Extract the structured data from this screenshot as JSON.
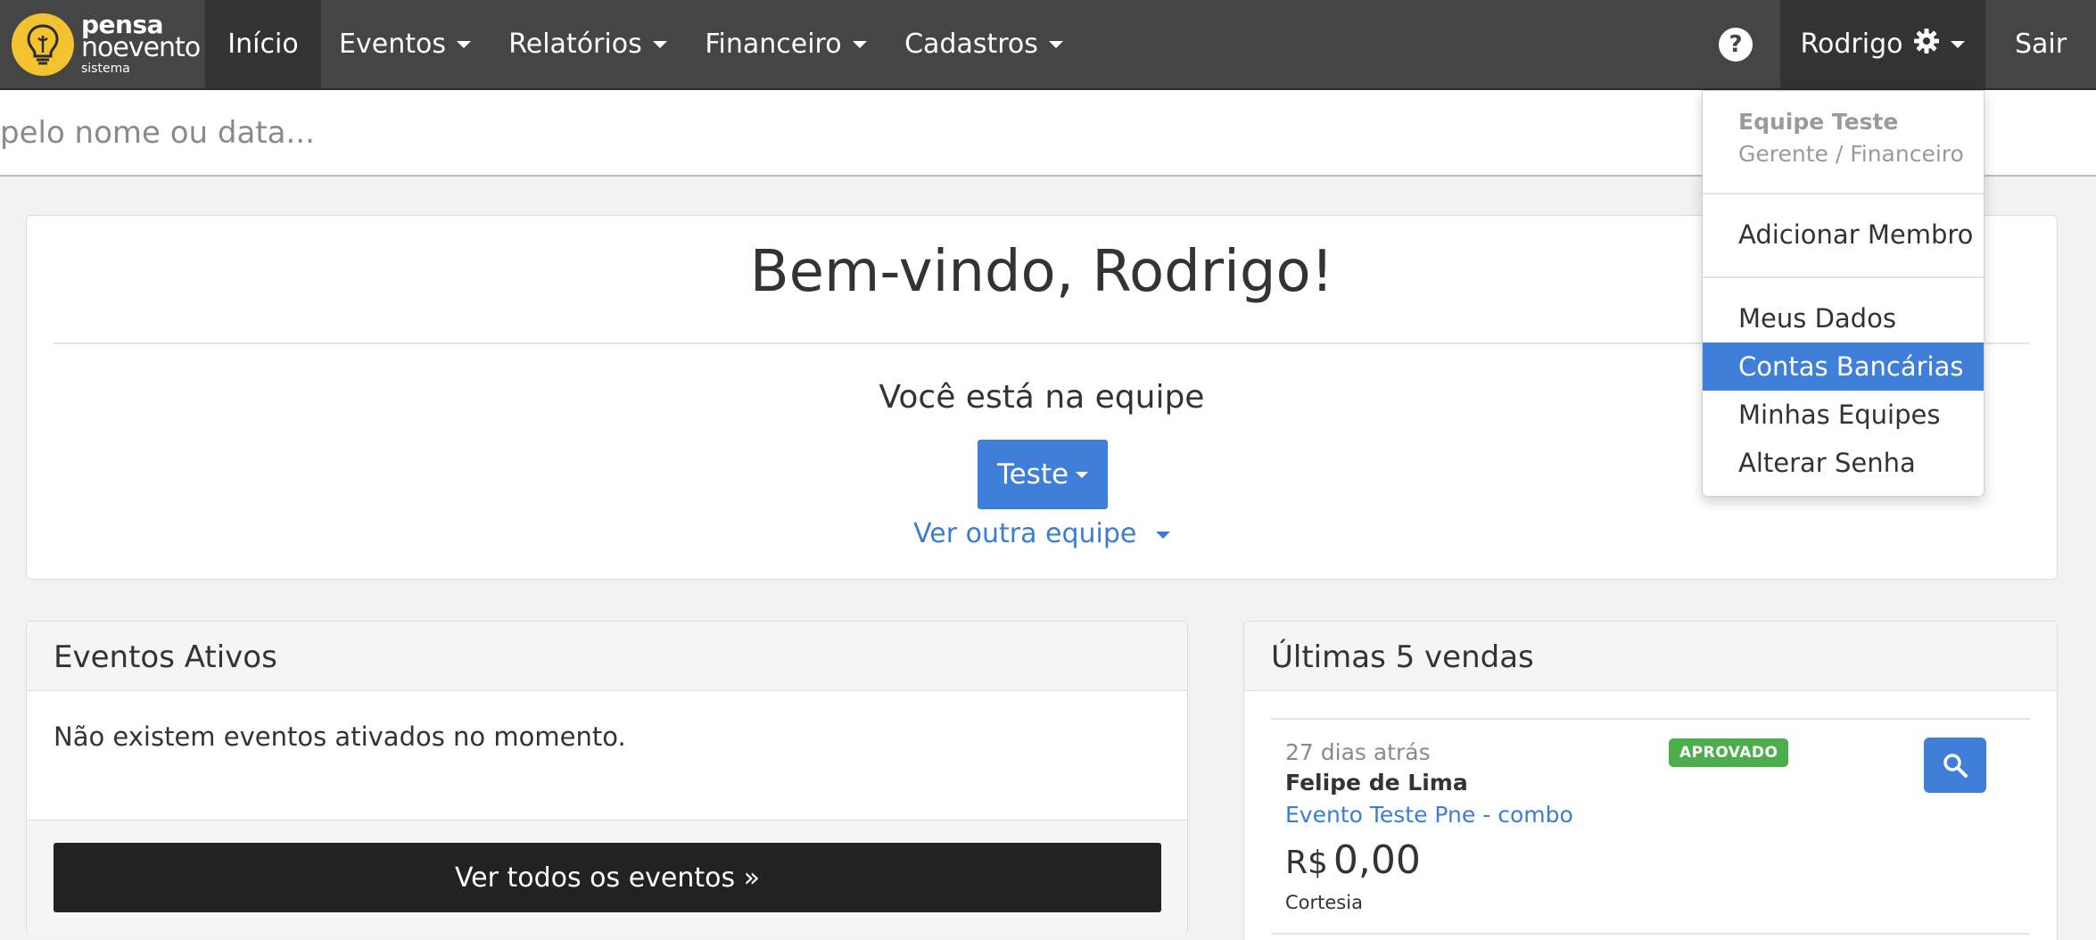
{
  "brand": {
    "line1": "pensa",
    "line2": "noevento",
    "line3": "sistema",
    "logo_icon": "lightbulb-icon",
    "logo_color": "#f2c230"
  },
  "nav": {
    "home": "Início",
    "events": "Eventos",
    "reports": "Relatórios",
    "financial": "Financeiro",
    "registers": "Cadastros",
    "help_symbol": "?",
    "user": "Rodrigo",
    "logout": "Sair"
  },
  "search": {
    "placeholder": "pelo nome ou data..."
  },
  "welcome": {
    "title": "Bem-vindo, Rodrigo!",
    "subtitle": "Você está na equipe",
    "team_button": "Teste",
    "other_team": "Ver outra equipe"
  },
  "active_events": {
    "title": "Eventos Ativos",
    "empty_message": "Não existem eventos ativados no momento.",
    "view_all_button": "Ver todos os eventos »"
  },
  "latest_sales": {
    "title": "Últimas 5 vendas",
    "items": [
      {
        "time": "27 dias atrás",
        "buyer": "Felipe de Lima",
        "event": "Evento Teste Pne - combo",
        "currency": "R$",
        "amount": "0,00",
        "type": "Cortesia",
        "status": "APROVADO"
      }
    ]
  },
  "user_menu": {
    "team_name": "Equipe Teste",
    "role": "Gerente / Financeiro",
    "add_member": "Adicionar Membro",
    "my_data": "Meus Dados",
    "bank_accounts": "Contas Bancárias",
    "my_teams": "Minhas Equipes",
    "change_password": "Alterar Senha",
    "highlighted_item": "Contas Bancárias"
  },
  "colors": {
    "navbar": "#454545",
    "primary": "#3f7fd9",
    "success": "#4cae4c",
    "link": "#3a7dd4",
    "dark_button": "#222222"
  }
}
